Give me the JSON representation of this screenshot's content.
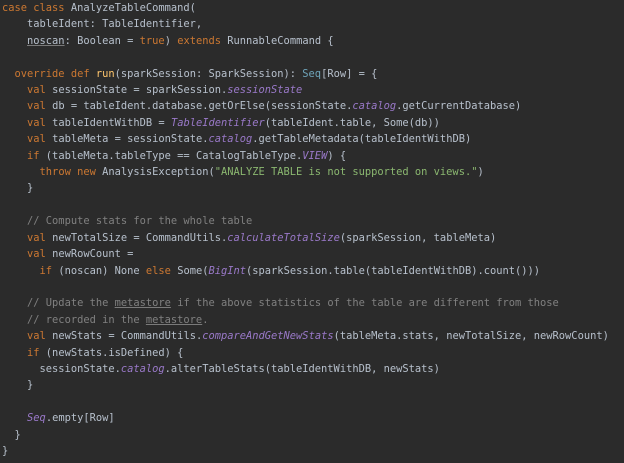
{
  "lines": [
    "case class AnalyzeTableCommand(",
    "    tableIdent: TableIdentifier,",
    "    noscan: Boolean = true) extends RunnableCommand {",
    "",
    "  override def run(sparkSession: SparkSession): Seq[Row] = {",
    "    val sessionState = sparkSession.sessionState",
    "    val db = tableIdent.database.getOrElse(sessionState.catalog.getCurrentDatabase)",
    "    val tableIdentWithDB = TableIdentifier(tableIdent.table, Some(db))",
    "    val tableMeta = sessionState.catalog.getTableMetadata(tableIdentWithDB)",
    "    if (tableMeta.tableType == CatalogTableType.VIEW) {",
    "      throw new AnalysisException(\"ANALYZE TABLE is not supported on views.\")",
    "    }",
    "",
    "    // Compute stats for the whole table",
    "    val newTotalSize = CommandUtils.calculateTotalSize(sparkSession, tableMeta)",
    "    val newRowCount =",
    "      if (noscan) None else Some(BigInt(sparkSession.table(tableIdentWithDB).count()))",
    "",
    "    // Update the metastore if the above statistics of the table are different from those",
    "    // recorded in the metastore.",
    "    val newStats = CommandUtils.compareAndGetNewStats(tableMeta.stats, newTotalSize, newRowCount)",
    "    if (newStats.isDefined) {",
    "      sessionState.catalog.alterTableStats(tableIdentWithDB, newStats)",
    "    }",
    "",
    "    Seq.empty[Row]",
    "  }",
    "}"
  ],
  "colors": {
    "background": "#2b2b2b",
    "keyword": "#cc7832",
    "string": "#8bb870",
    "comment": "#808080",
    "field": "#9a79c9",
    "default": "#b7c0cc"
  }
}
